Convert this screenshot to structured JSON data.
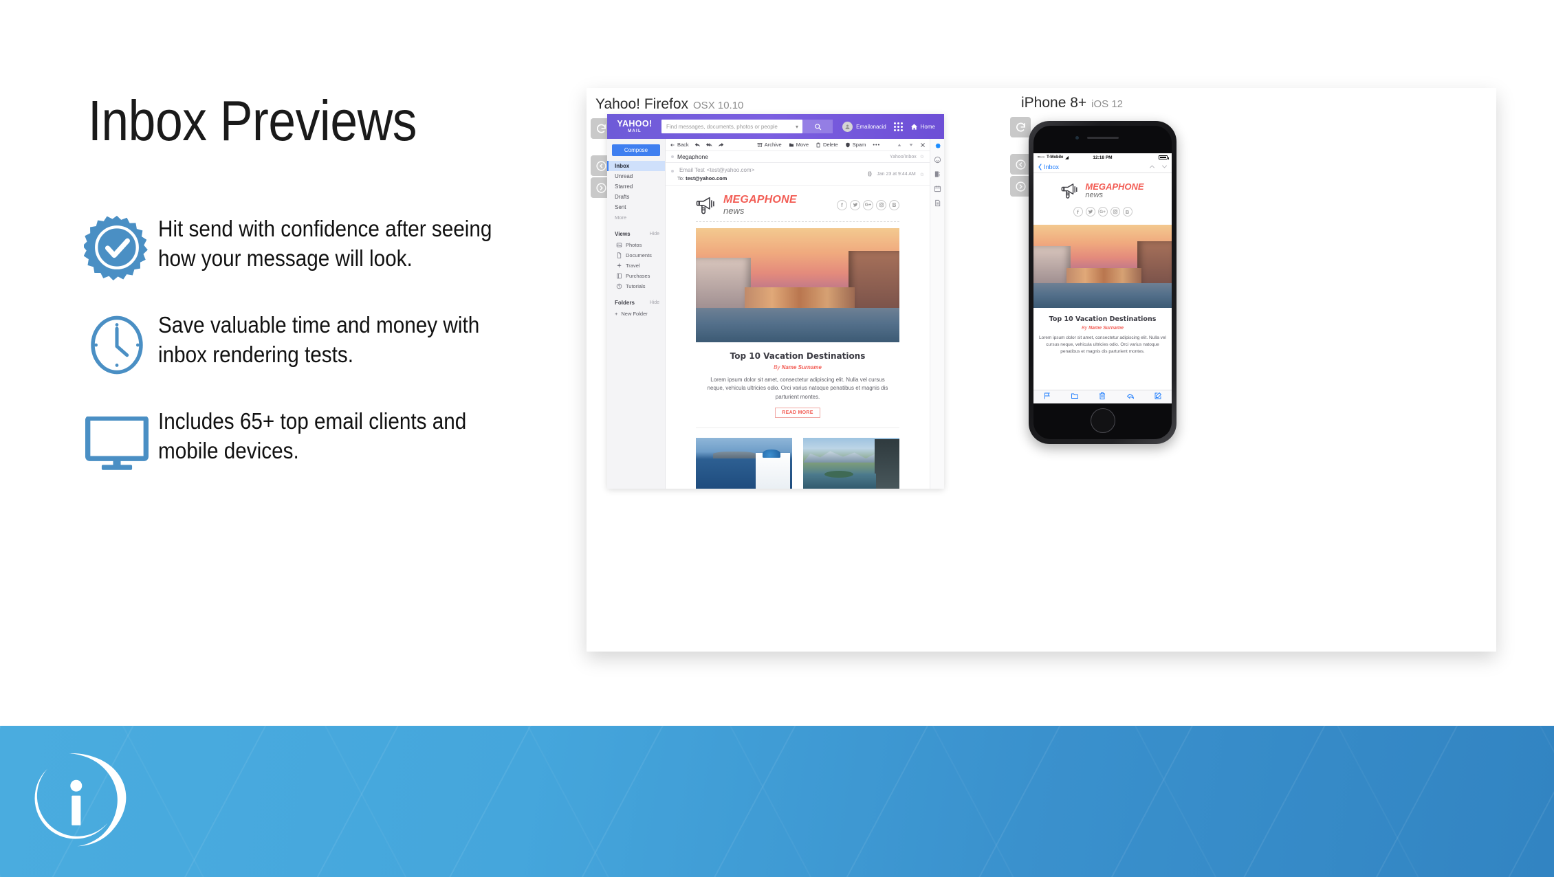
{
  "slide": {
    "title": "Inbox Previews",
    "bullets": [
      {
        "icon": "badge-check-icon",
        "text": "Hit send with confidence after seeing how your message will look."
      },
      {
        "icon": "clock-icon",
        "text": "Save valuable time and money with inbox rendering tests."
      },
      {
        "icon": "monitor-icon",
        "text": "Includes 65+ top email clients and mobile devices."
      }
    ],
    "accent_color": "#4a8fc4",
    "banner_color": "#45a6dc"
  },
  "previews": {
    "desktop": {
      "client": "Yahoo! Firefox",
      "os": "OSX 10.10"
    },
    "mobile": {
      "device": "iPhone 8+",
      "os": "iOS 12"
    },
    "controls": {
      "refresh": "refresh-icon",
      "prev": "previous-icon",
      "next": "next-icon"
    }
  },
  "yahoo": {
    "logo_line1": "YAHOO!",
    "logo_line2": "MAIL",
    "search_placeholder": "Find messages, documents, photos or people",
    "search_value": "",
    "search_button": "search-icon",
    "account_name": "Emailonacid",
    "apps_icon": "apps-grid-icon",
    "home_label": "Home",
    "sidebar": {
      "compose": "Compose",
      "folders": [
        "Inbox",
        "Unread",
        "Starred",
        "Drafts",
        "Sent"
      ],
      "more": "More",
      "views_header": "Views",
      "views_hide": "Hide",
      "views": [
        {
          "label": "Photos",
          "icon": "photo-icon"
        },
        {
          "label": "Documents",
          "icon": "document-icon"
        },
        {
          "label": "Travel",
          "icon": "plane-icon"
        },
        {
          "label": "Purchases",
          "icon": "receipt-icon"
        },
        {
          "label": "Tutorials",
          "icon": "help-icon"
        }
      ],
      "folders_header": "Folders",
      "folders_hide": "Hide",
      "new_folder": "New Folder"
    },
    "toolbar": {
      "back": "Back",
      "reply": "reply-icon",
      "reply_all": "reply-all-icon",
      "forward": "forward-icon",
      "archive": "Archive",
      "move": "Move",
      "delete": "Delete",
      "spam": "Spam",
      "more": "•••",
      "up": "chevron-up-icon",
      "down": "chevron-down-icon",
      "close": "close-icon"
    },
    "message": {
      "subject": "Megaphone",
      "location": "Yahoo/Inbox",
      "from_name": "Email Test",
      "from_address": "<test@yahoo.com>",
      "to_label": "To:",
      "to_address": "test@yahoo.com",
      "timestamp": "Jan 23 at 9:44 AM",
      "print_icon": "print-icon",
      "star_icon": "star-icon"
    },
    "rail": [
      "gear-icon",
      "smiley-icon",
      "contacts-icon",
      "calendar-icon",
      "notepad-icon"
    ]
  },
  "email": {
    "brand_line1": "MEGAPHONE",
    "brand_line2": "news",
    "brand_color": "#f25c54",
    "socials": [
      "facebook-icon",
      "twitter-icon",
      "google-plus-icon",
      "instagram-icon",
      "blogger-icon"
    ],
    "article_title": "Top 10 Vacation Destinations",
    "byline_prefix": "By ",
    "byline_author": "Name Surname",
    "body": "Lorem ipsum dolor sit amet, consectetur adipiscing elit. Nulla vel cursus neque, vehicula ultricies odio. Orci varius natoque penatibus et magnis dis parturient montes.",
    "cta": "READ MORE",
    "hero_alt": "venice-grand-canal-sunset",
    "thumbs": [
      "santorini-blue-dome",
      "queenstown-lake-overlook"
    ]
  },
  "iphone": {
    "status": {
      "signal": "••○○○",
      "carrier": "T-Mobile",
      "wifi": "wifi-icon",
      "time": "12:18 PM",
      "battery": "battery-icon"
    },
    "nav": {
      "back_label": "Inbox",
      "up": "chevron-up-icon",
      "down": "chevron-down-icon"
    },
    "toolbar": [
      "flag-icon",
      "folder-icon",
      "trash-icon",
      "reply-icon",
      "compose-icon"
    ]
  }
}
